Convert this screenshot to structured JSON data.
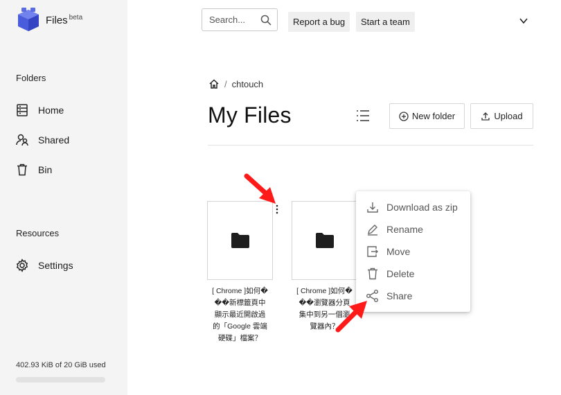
{
  "app": {
    "name": "Files",
    "badge": "beta"
  },
  "sidebar": {
    "folders_title": "Folders",
    "folders": [
      {
        "label": "Home",
        "icon": "home-list-icon"
      },
      {
        "label": "Shared",
        "icon": "shared-users-icon"
      },
      {
        "label": "Bin",
        "icon": "trash-icon"
      }
    ],
    "resources_title": "Resources",
    "resources": [
      {
        "label": "Settings",
        "icon": "gear-icon"
      }
    ],
    "usage_text": "402.93 KiB of 20 GiB used",
    "usage_fraction": 0.0
  },
  "topbar": {
    "search_placeholder": "Search...",
    "report_bug_label": "Report a bug",
    "start_team_label": "Start a team"
  },
  "breadcrumb": {
    "items": [
      "chtouch"
    ]
  },
  "main": {
    "title": "My Files",
    "new_folder_label": "New folder",
    "upload_label": "Upload"
  },
  "files": [
    {
      "name": "[ Chrome ]如何�\n��新標籤頁中\n顯示最近開啟過\n的「Google 雲端\n硬碟」檔案？",
      "type": "folder"
    },
    {
      "name": "[ Chrome ]如何�\n��瀏覽器分頁\n集中到另一個瀏\n覽器內？",
      "type": "folder"
    }
  ],
  "context_menu": {
    "items": [
      {
        "label": "Download as zip",
        "icon": "download-icon"
      },
      {
        "label": "Rename",
        "icon": "pencil-icon"
      },
      {
        "label": "Move",
        "icon": "move-icon"
      },
      {
        "label": "Delete",
        "icon": "trash-icon"
      },
      {
        "label": "Share",
        "icon": "share-icon"
      }
    ]
  },
  "colors": {
    "brand": "#4a5bdc",
    "annotation": "#ff1a1a",
    "sidebar_bg": "#f4f4f4"
  }
}
